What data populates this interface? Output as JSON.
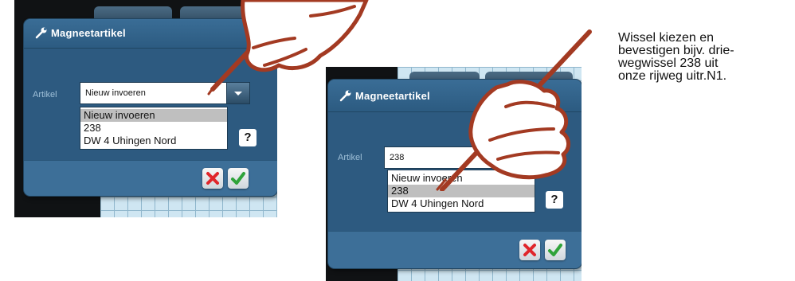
{
  "screens": [
    {
      "dialog_title": "Magneetartikel",
      "field_label": "Artikel",
      "field_value": "Nieuw invoeren",
      "options": [
        "Nieuw invoeren",
        "238",
        "DW 4 Uhingen Nord"
      ],
      "selected_index": 0,
      "help_label": "?"
    },
    {
      "dialog_title": "Magneetartikel",
      "field_label": "Artikel",
      "field_value": "238",
      "options": [
        "Nieuw invoeren",
        "238",
        "DW 4 Uhingen Nord"
      ],
      "selected_index": 1,
      "help_label": "?"
    }
  ],
  "caption": "Wissel kiezen en bevestigen bijv. drie-wegwissel 238 uit onze rijweg uitr.N1.",
  "caption_lines": [
    "Wissel kiezen en",
    "bevestigen bijv. drie-",
    "wegwissel 238 uit",
    "onze rijweg uitr.N1."
  ],
  "icons": {
    "title": "wrench-icon",
    "cancel": "cancel-x-icon",
    "confirm": "confirm-check-icon",
    "pointer": "hand-stylus-icon"
  },
  "colors": {
    "dialog": "#2d5a80",
    "cancel": "#e0262b",
    "confirm": "#2fa33a",
    "hand": "#a33a22",
    "selection": "#bfbfbf"
  }
}
